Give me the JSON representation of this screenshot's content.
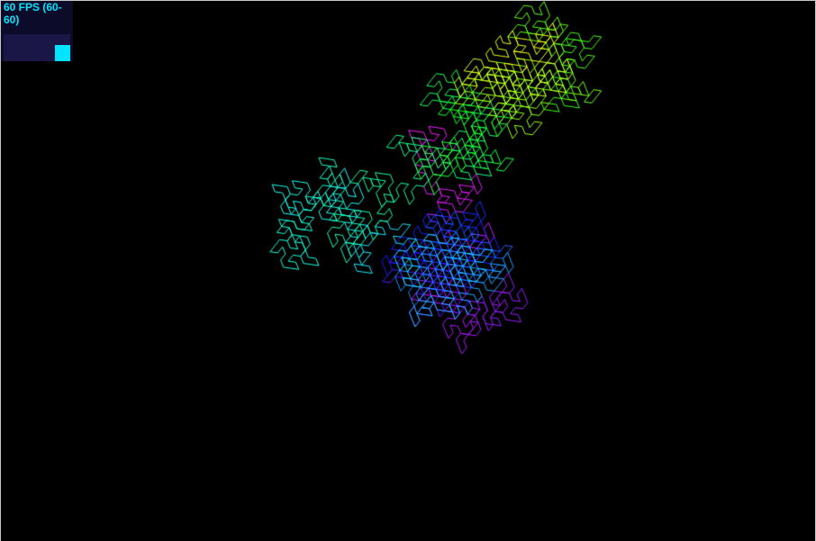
{
  "stats": {
    "fps_text": "60 FPS (60-60)",
    "fps": 60,
    "fps_min": 60,
    "fps_max": 60,
    "graph_fill_fraction": 0.6,
    "text_color": "#00e5ff",
    "panel_color": "#0c0c2a",
    "graph_bg_color": "#1a1646"
  },
  "scene": {
    "background_color": "#000000",
    "pattern": "gosper-flowsnake-curve",
    "gradient_colors": [
      "#ffff00",
      "#00ff00",
      "#00ffff",
      "#0044ff",
      "#ff00ff",
      "#ffffff"
    ]
  }
}
